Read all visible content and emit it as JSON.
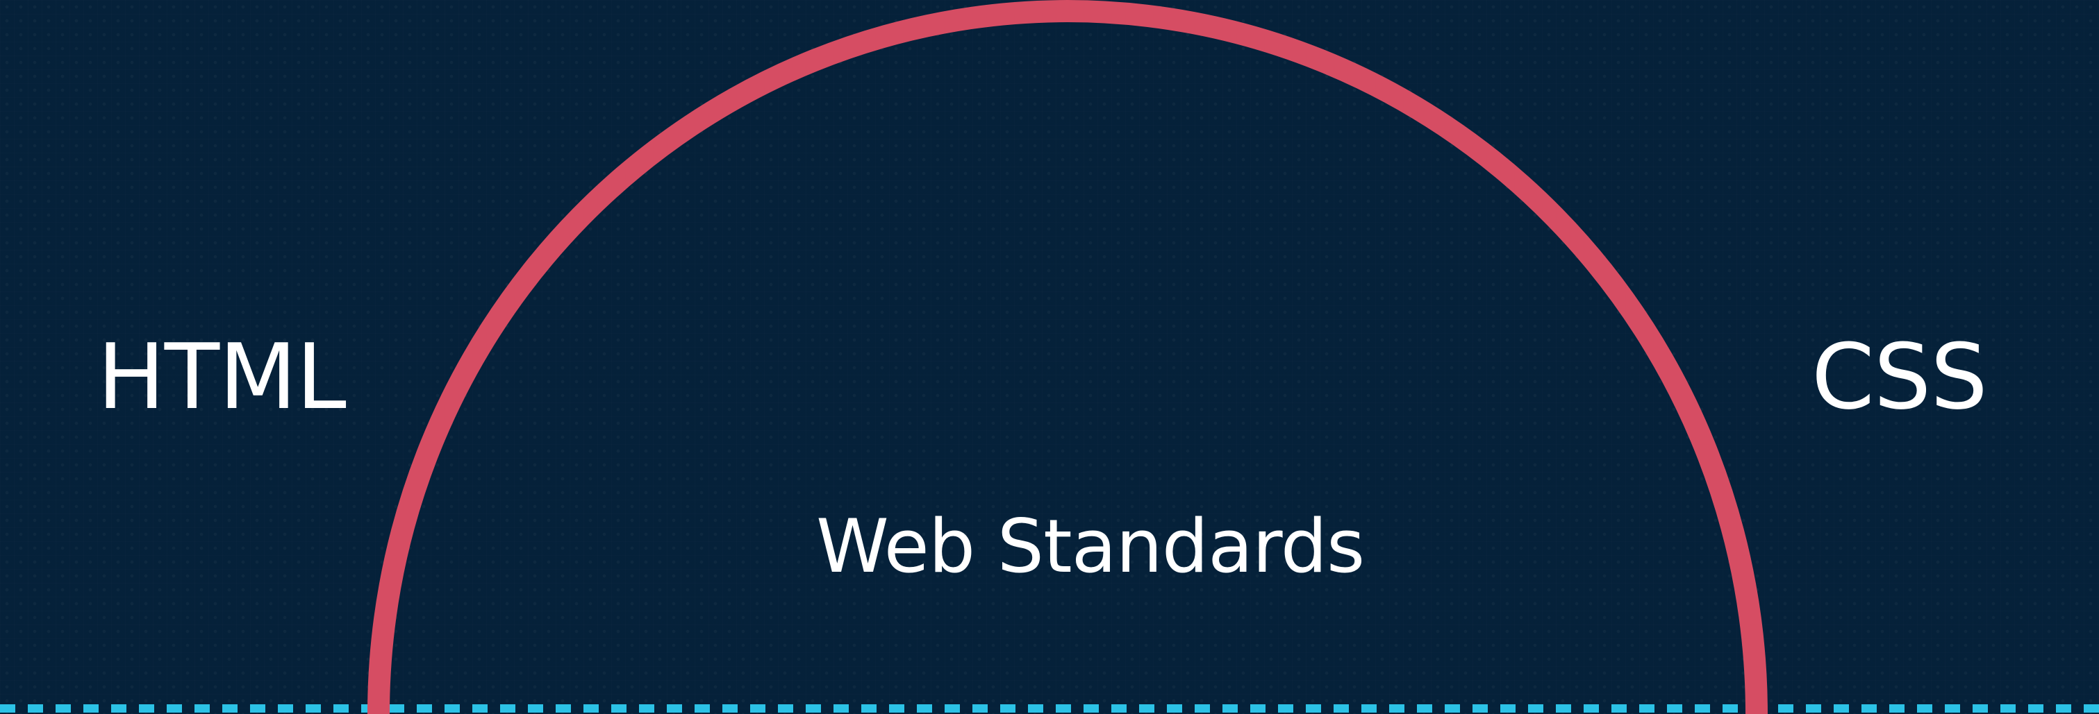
{
  "diagram": {
    "left_label": "HTML",
    "right_label": "CSS",
    "center_label": "Web Standards"
  },
  "colors": {
    "background": "#05233d",
    "arc": "#d64d63",
    "dashed_line": "#2cc2e6",
    "text": "#ffffff"
  }
}
